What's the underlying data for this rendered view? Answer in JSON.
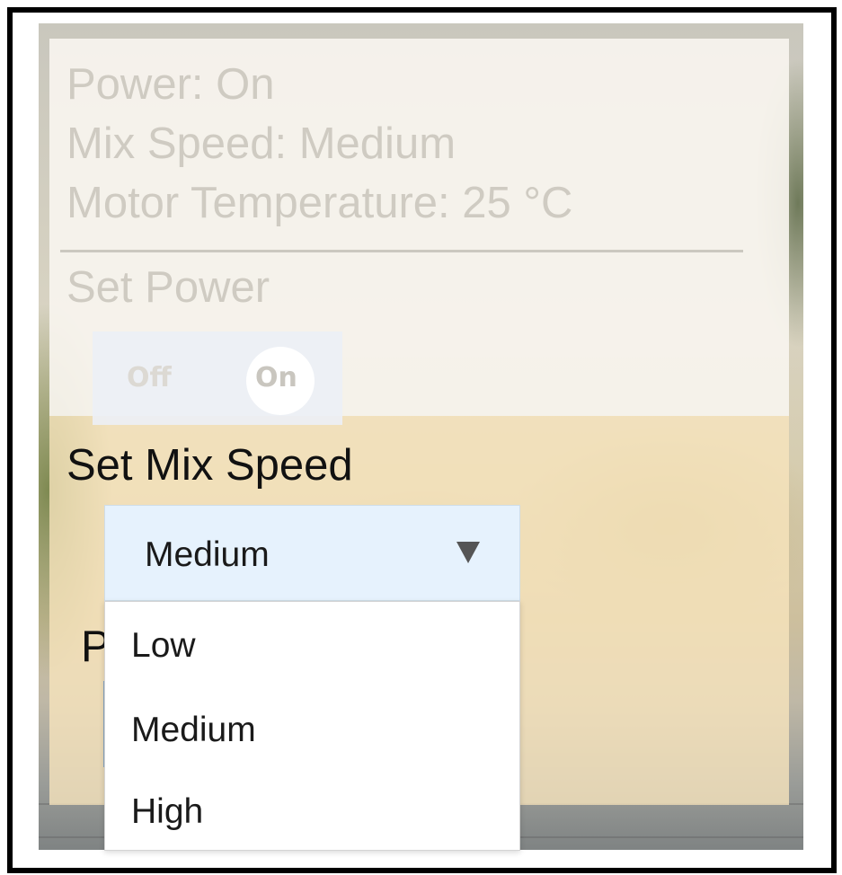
{
  "status": {
    "power": "Power: On",
    "mix_speed": "Mix Speed: Medium",
    "motor_temperature": "Motor Temperature: 25 °C"
  },
  "set_power": {
    "label": "Set Power",
    "options": [
      "Off",
      "On"
    ],
    "selected": "On"
  },
  "set_mix_speed": {
    "label": "Set Mix Speed",
    "selected": "Medium",
    "options": [
      "Low",
      "Medium",
      "High"
    ]
  },
  "partially_hidden_label": "P",
  "colors": {
    "panel_top_bg": "#f7f4ee",
    "panel_bottom_bg": "#f9e5be",
    "select_bg": "#e6f2fd",
    "faded_text": "#cfcbc2"
  },
  "icons": {
    "select_arrow": "triangle-down-icon"
  }
}
